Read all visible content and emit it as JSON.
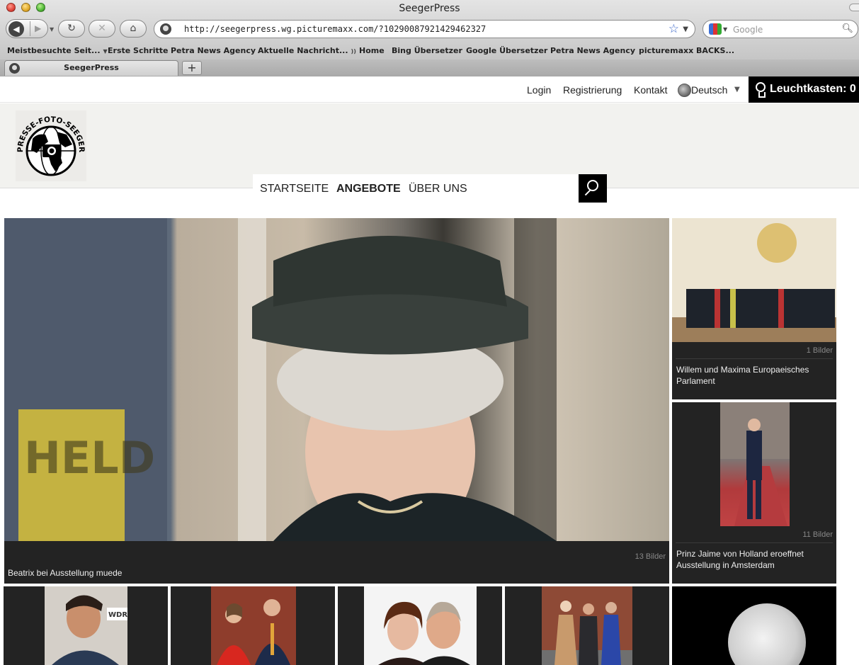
{
  "browser": {
    "window_title": "SeegerPress",
    "url": "http://seegerpress.wg.picturemaxx.com/?10290087921429462327",
    "search_placeholder": "Google",
    "bookmarks": [
      "Meistbesuchte Seit...",
      "Erste Schritte",
      "Petra News Agency",
      "Aktuelle Nachricht...",
      "Home",
      "Bing Übersetzer",
      "Google Übersetzer",
      "Petra News Agency",
      "picturemaxx BACKS..."
    ],
    "tab_title": "SeegerPress",
    "new_tab_label": "+"
  },
  "topbar": {
    "login": "Login",
    "register": "Registrierung",
    "contact": "Kontakt",
    "language": "Deutsch",
    "lightbox_label": "Leuchtkasten: 0"
  },
  "logo": {
    "text": "PRESSE-FOTO-SEEGER"
  },
  "nav": {
    "items": [
      "STARTSEITE",
      "ANGEBOTE",
      "ÜBER UNS"
    ]
  },
  "gallery": {
    "main": {
      "count": "13 Bilder",
      "caption": "Beatrix bei Ausstellung muede",
      "sign_text": "HELD"
    },
    "right1": {
      "count": "1 Bilder",
      "caption": "Willem und Maxima Europaeisches Parlament"
    },
    "right2": {
      "count": "11 Bilder",
      "caption": "Prinz Jaime von Holland eroeffnet Ausstellung in Amsterdam"
    },
    "b1": {
      "badge": "WDR"
    }
  },
  "colors": {
    "tile_background": "#232323",
    "header_band": "#f2f2ef",
    "lightbox_background": "#000000",
    "url_star": "#3a67c8"
  }
}
